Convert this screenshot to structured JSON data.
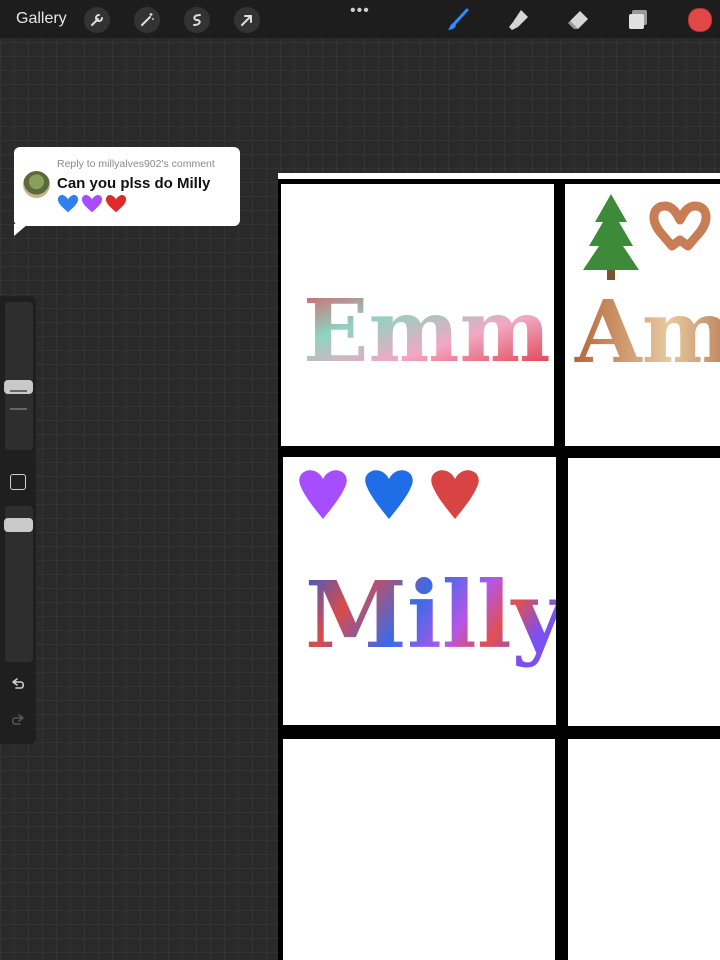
{
  "toolbar": {
    "gallery_label": "Gallery",
    "more_label": "•••",
    "current_color": "#e04848",
    "left_tools": [
      "wrench-icon",
      "magic-wand-icon",
      "selection-s-icon",
      "transform-arrow-icon"
    ],
    "right_tools": [
      "brush-icon",
      "smudge-icon",
      "eraser-icon",
      "layers-icon",
      "color-picker"
    ]
  },
  "comment": {
    "reply_to": "Reply to millyalves902's comment",
    "text": "Can you plss do Milly",
    "hearts": [
      "#2f7ff0",
      "#a64dff",
      "#e02a2a"
    ]
  },
  "canvas": {
    "names": [
      {
        "text": "Emma"
      },
      {
        "text": "Ami"
      },
      {
        "text": "Milly"
      }
    ],
    "milly_hearts": [
      "#a64dff",
      "#1f6ee8",
      "#d84444"
    ]
  }
}
